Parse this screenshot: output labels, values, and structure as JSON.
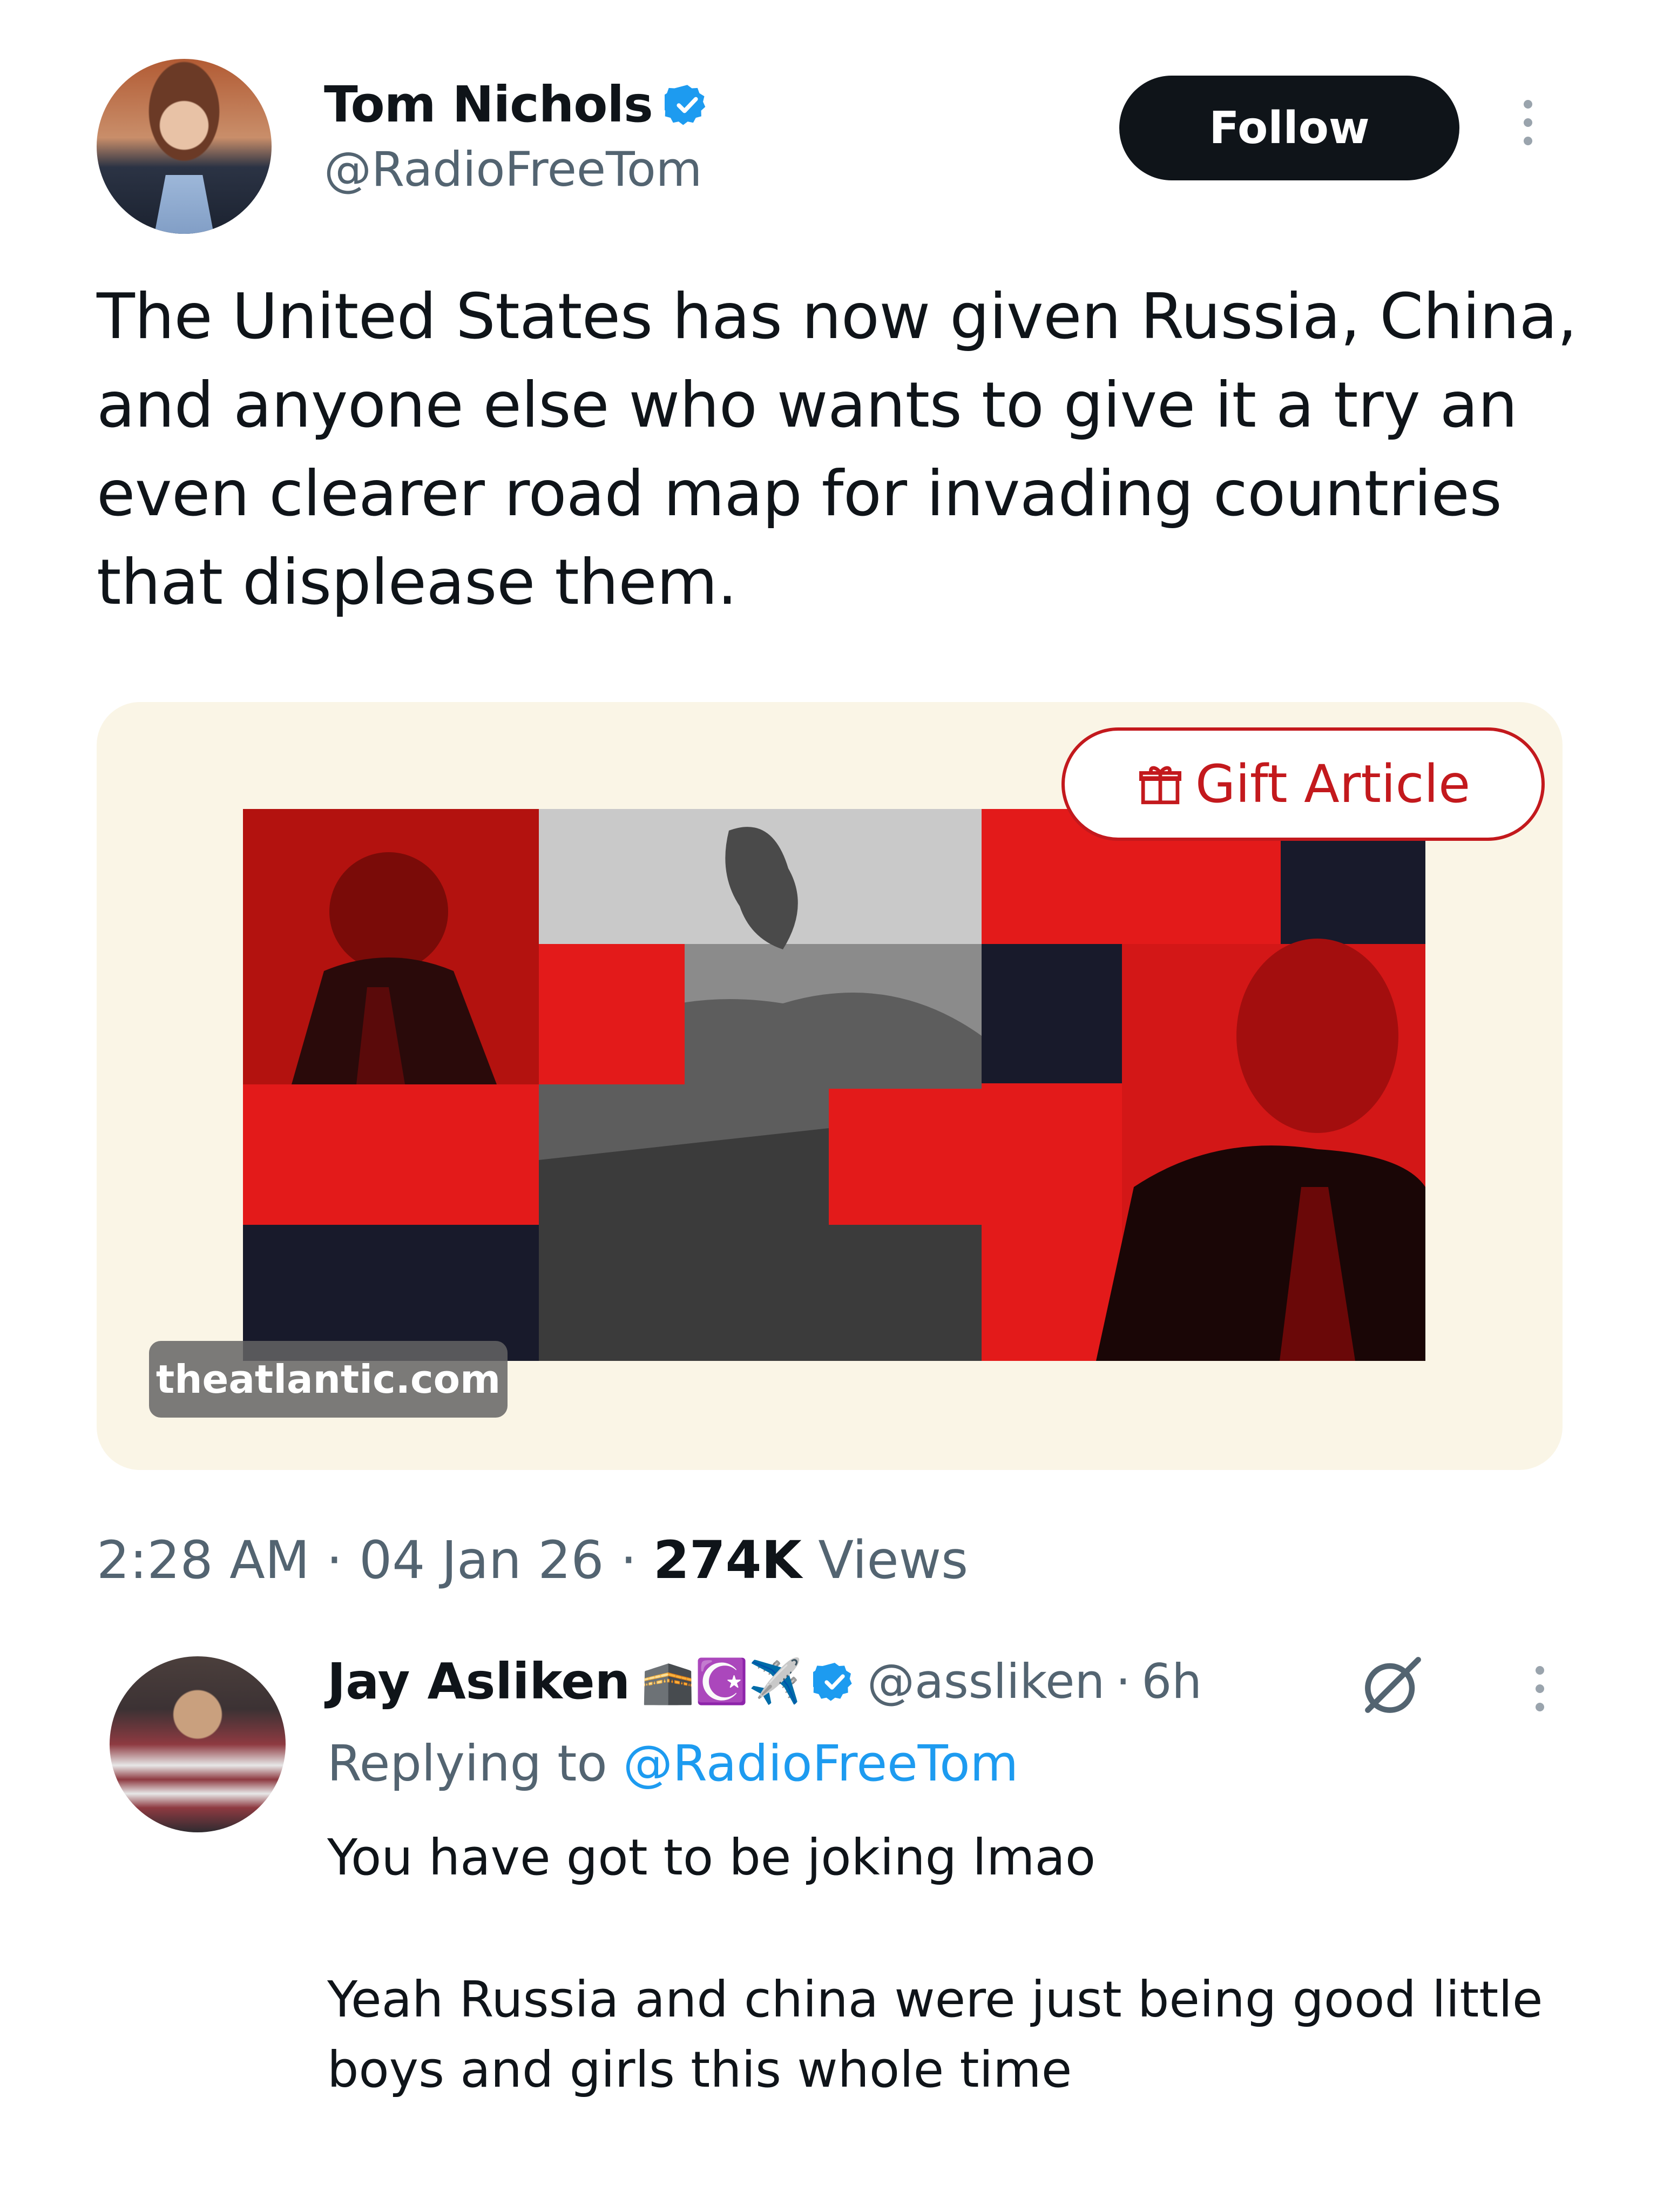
{
  "tweet": {
    "author_name": "Tom Nichols",
    "handle": "@RadioFreeTom",
    "follow_label": "Follow",
    "text": "The United States has now given Russia, China, and anyone else who wants to give it a try an even clearer road map for invading countries that displease them.",
    "card": {
      "gift_label": "Gift Article",
      "source": "theatlantic.com"
    },
    "time": "2:28 AM",
    "date": "04 Jan 26",
    "views_count": "274K",
    "views_label": "Views",
    "separator": "·"
  },
  "reply": {
    "author_name": "Jay Asliken",
    "name_emojis": "🕋☪️✈️",
    "handle": "@assliken",
    "age": "6h",
    "replying_prefix": "Replying to",
    "replying_handle": "@RadioFreeTom",
    "text_line1": "You have got to be joking lmao",
    "text_line2": "Yeah Russia and china were just being good little boys and girls this whole time"
  },
  "colors": {
    "accent": "#1d9bf0",
    "text_primary": "#0f1419",
    "text_secondary": "#536471",
    "atlantic_red": "#c3191d",
    "card_bg": "#faf5e6"
  },
  "icons": [
    "verified-badge-icon",
    "more-options-icon",
    "gift-icon",
    "grok-icon",
    "verified-badge-icon"
  ]
}
